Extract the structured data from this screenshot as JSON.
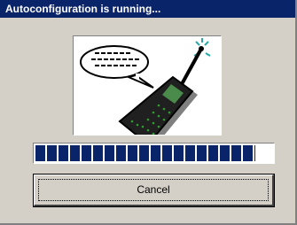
{
  "window": {
    "title": "Autoconfiguration is running..."
  },
  "illustration": {
    "icon": "mobile-phone-with-speech-bubble"
  },
  "progress": {
    "fraction": 0.93,
    "segment_color": "#0a246a"
  },
  "buttons": {
    "cancel_label": "Cancel"
  },
  "colors": {
    "titlebar": "#0a246a",
    "face": "#d4d0c8"
  }
}
